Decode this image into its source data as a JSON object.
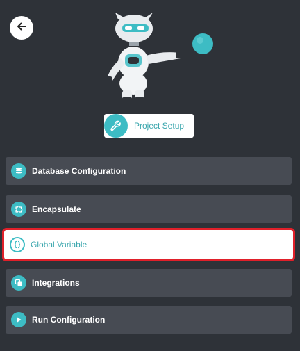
{
  "nav": {
    "back_icon": "arrow-left-icon"
  },
  "mascot": {
    "icon": "robot-mascot-icon"
  },
  "project_setup": {
    "label": "Project Setup",
    "icon": "wrench-icon"
  },
  "menu": {
    "items": [
      {
        "label": "Database Configuration",
        "icon": "database-icon",
        "active": false
      },
      {
        "label": "Encapsulate",
        "icon": "puzzle-icon",
        "active": false
      },
      {
        "label": "Global Variable",
        "icon": "braces-icon",
        "active": true
      },
      {
        "label": "Integrations",
        "icon": "integrations-icon",
        "active": false
      },
      {
        "label": "Run Configuration",
        "icon": "play-icon",
        "active": false
      }
    ]
  },
  "colors": {
    "background": "#2e3238",
    "menu_item": "#474b53",
    "accent": "#3dbcc4",
    "highlight_border": "#e0202a"
  }
}
